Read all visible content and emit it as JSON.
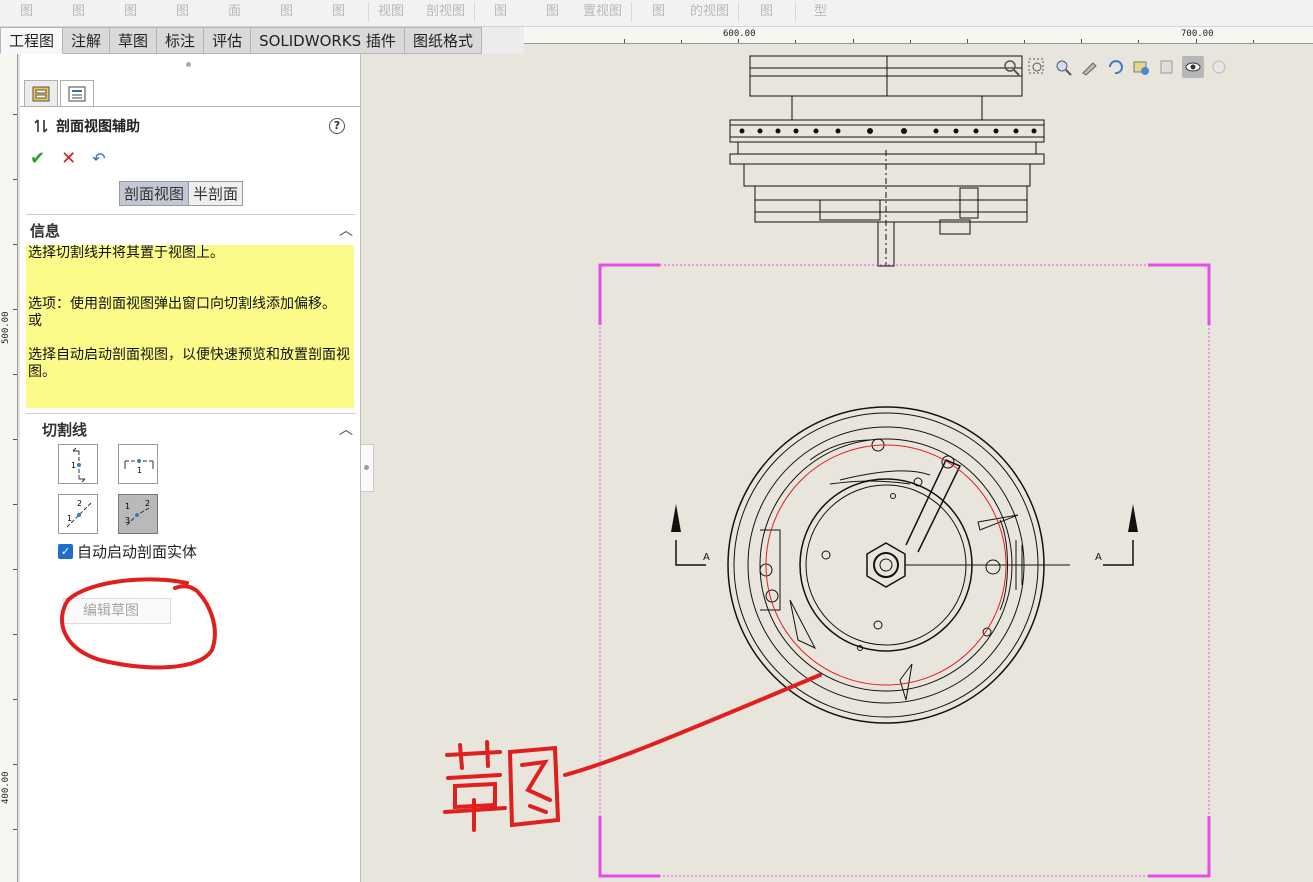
{
  "ribbon_ghost": [
    "图",
    "图",
    "图",
    "图",
    "面",
    "图",
    "图",
    "视图",
    "剖视图",
    "图",
    "图",
    "置视图",
    "图",
    "的视图",
    "图",
    "型"
  ],
  "tabs": [
    "工程图",
    "注解",
    "草图",
    "标注",
    "评估",
    "SOLIDWORKS 插件",
    "图纸格式"
  ],
  "ruler": {
    "h_labels": [
      "600.00",
      "700.00"
    ],
    "v_labels": [
      "500.00",
      "400.00"
    ]
  },
  "panel": {
    "title": "剖面视图辅助",
    "help": "?",
    "ok": "✔",
    "cancel": "✕",
    "undo": "↶",
    "seg_section": "剖面视图",
    "seg_half": "半剖面",
    "info_title": "信息",
    "info_lines": [
      "选择切割线并将其置于视图上。",
      "",
      "",
      "选项：使用剖面视图弹出窗口向切割线添加偏移。",
      "或",
      "",
      "选择自动启动剖面视图，以便快速预览和放置剖面视图。"
    ],
    "cutline_title": "切割线",
    "auto_checkbox_label": "自动启动剖面实体",
    "auto_checked": true,
    "edit_sketch_label": "编辑草图"
  },
  "drawing": {
    "section_label_left": "A",
    "section_label_right": "A"
  },
  "handwritten_note": "草图",
  "colors": {
    "magenta_frame": "#e64ce6",
    "red_annotation": "#e0201e",
    "info_bg": "#fbfb8a"
  }
}
